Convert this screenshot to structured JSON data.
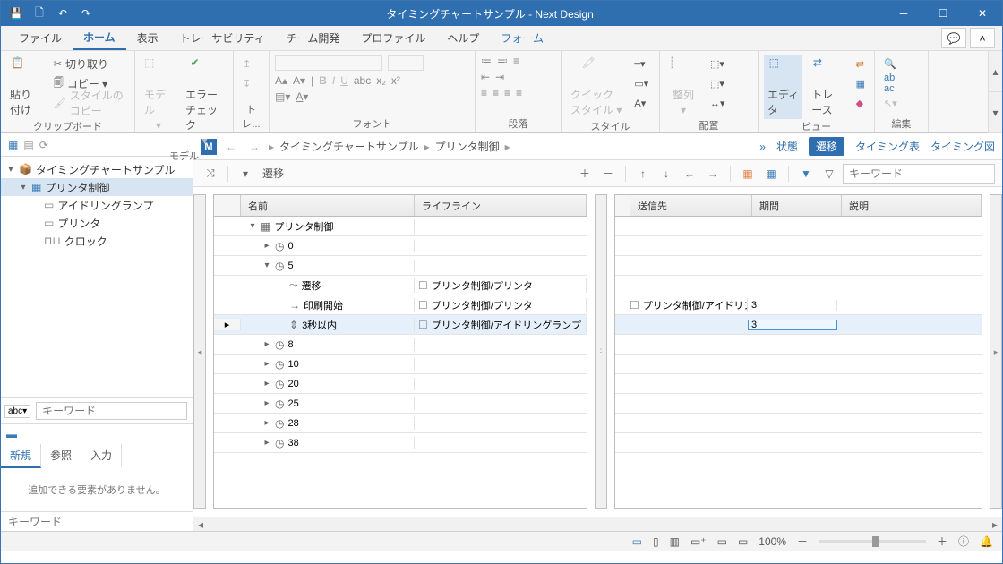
{
  "title": "タイミングチャートサンプル - Next Design",
  "menu": [
    "ファイル",
    "ホーム",
    "表示",
    "トレーサビリティ",
    "チーム開発",
    "プロファイル",
    "ヘルプ",
    "フォーム"
  ],
  "menu_active": 1,
  "menu_link": 7,
  "ribbonGroups": {
    "clipboard": {
      "label": "クリップボード",
      "paste": "貼り付け",
      "cut": "切り取り",
      "copy": "コピー ▾",
      "style": "スタイルのコピー"
    },
    "model": {
      "label": "モデル",
      "model": "モデル",
      "errchk": "エラーチェック"
    },
    "trace": {
      "label": "トレ..."
    },
    "font": {
      "label": "フォント"
    },
    "para": {
      "label": "段落"
    },
    "style": {
      "label": "スタイル",
      "quick": "クイック\nスタイル ▾"
    },
    "layout": {
      "label": "配置",
      "align": "整列"
    },
    "view": {
      "label": "ビュー",
      "edit": "エディタ",
      "trace": "トレース"
    },
    "edit": {
      "label": "編集"
    }
  },
  "tree": {
    "root": "タイミングチャートサンプル",
    "sel": "プリンタ制御",
    "children": [
      "アイドリングランプ",
      "プリンタ",
      "クロック"
    ]
  },
  "filter_ph": "キーワード",
  "btm_tabs": [
    "新規",
    "参照",
    "入力"
  ],
  "btm_msg": "追加できる要素がありません。",
  "bc": {
    "items": [
      "タイミングチャートサンプル",
      "プリンタ制御"
    ],
    "more": "»",
    "links": {
      "state": "状態",
      "trans": "遷移",
      "timingtbl": "タイミング表",
      "timingchart": "タイミング図"
    }
  },
  "toolbar": {
    "trans": "遷移",
    "kw_ph": "キーワード"
  },
  "grid1": {
    "cols": [
      "",
      "名前",
      "ライフライン"
    ],
    "rows": [
      {
        "indent": 0,
        "exp": "▾",
        "icon": "app",
        "name": "プリンタ制御",
        "life": ""
      },
      {
        "indent": 1,
        "exp": "▸",
        "icon": "clk",
        "name": "0",
        "life": ""
      },
      {
        "indent": 1,
        "exp": "▾",
        "icon": "clk",
        "name": "5",
        "life": ""
      },
      {
        "indent": 2,
        "exp": "",
        "icon": "seg",
        "name": "遷移",
        "life": "プリンタ制御/プリンタ",
        "chk": true
      },
      {
        "indent": 2,
        "exp": "",
        "icon": "arr",
        "name": "印刷開始",
        "life": "プリンタ制御/プリンタ",
        "chk": true
      },
      {
        "indent": 2,
        "exp": "",
        "icon": "lim",
        "name": "3秒以内",
        "life": "プリンタ制御/アイドリングランプ",
        "chk": true,
        "sel": true
      },
      {
        "indent": 1,
        "exp": "▸",
        "icon": "clk",
        "name": "8",
        "life": ""
      },
      {
        "indent": 1,
        "exp": "▸",
        "icon": "clk",
        "name": "10",
        "life": ""
      },
      {
        "indent": 1,
        "exp": "▸",
        "icon": "clk",
        "name": "20",
        "life": ""
      },
      {
        "indent": 1,
        "exp": "▸",
        "icon": "clk",
        "name": "25",
        "life": ""
      },
      {
        "indent": 1,
        "exp": "▸",
        "icon": "clk",
        "name": "28",
        "life": ""
      },
      {
        "indent": 1,
        "exp": "▸",
        "icon": "clk",
        "name": "38",
        "life": ""
      }
    ]
  },
  "grid2": {
    "cols": [
      "",
      "送信先",
      "期間",
      "説明"
    ],
    "rows": [
      {
        "dest": "",
        "period": "",
        "desc": ""
      },
      {
        "dest": "",
        "period": "",
        "desc": ""
      },
      {
        "dest": "",
        "period": "",
        "desc": ""
      },
      {
        "dest": "",
        "period": "",
        "desc": ""
      },
      {
        "dest": "プリンタ制御/アイドリング:",
        "period": "3",
        "desc": "",
        "chk": true
      },
      {
        "dest": "",
        "period": "3",
        "desc": "",
        "sel": true
      },
      {
        "dest": "",
        "period": "",
        "desc": ""
      },
      {
        "dest": "",
        "period": "",
        "desc": ""
      },
      {
        "dest": "",
        "period": "",
        "desc": ""
      },
      {
        "dest": "",
        "period": "",
        "desc": ""
      },
      {
        "dest": "",
        "period": "",
        "desc": ""
      },
      {
        "dest": "",
        "period": "",
        "desc": ""
      }
    ]
  },
  "status": {
    "zoom": "100%"
  }
}
